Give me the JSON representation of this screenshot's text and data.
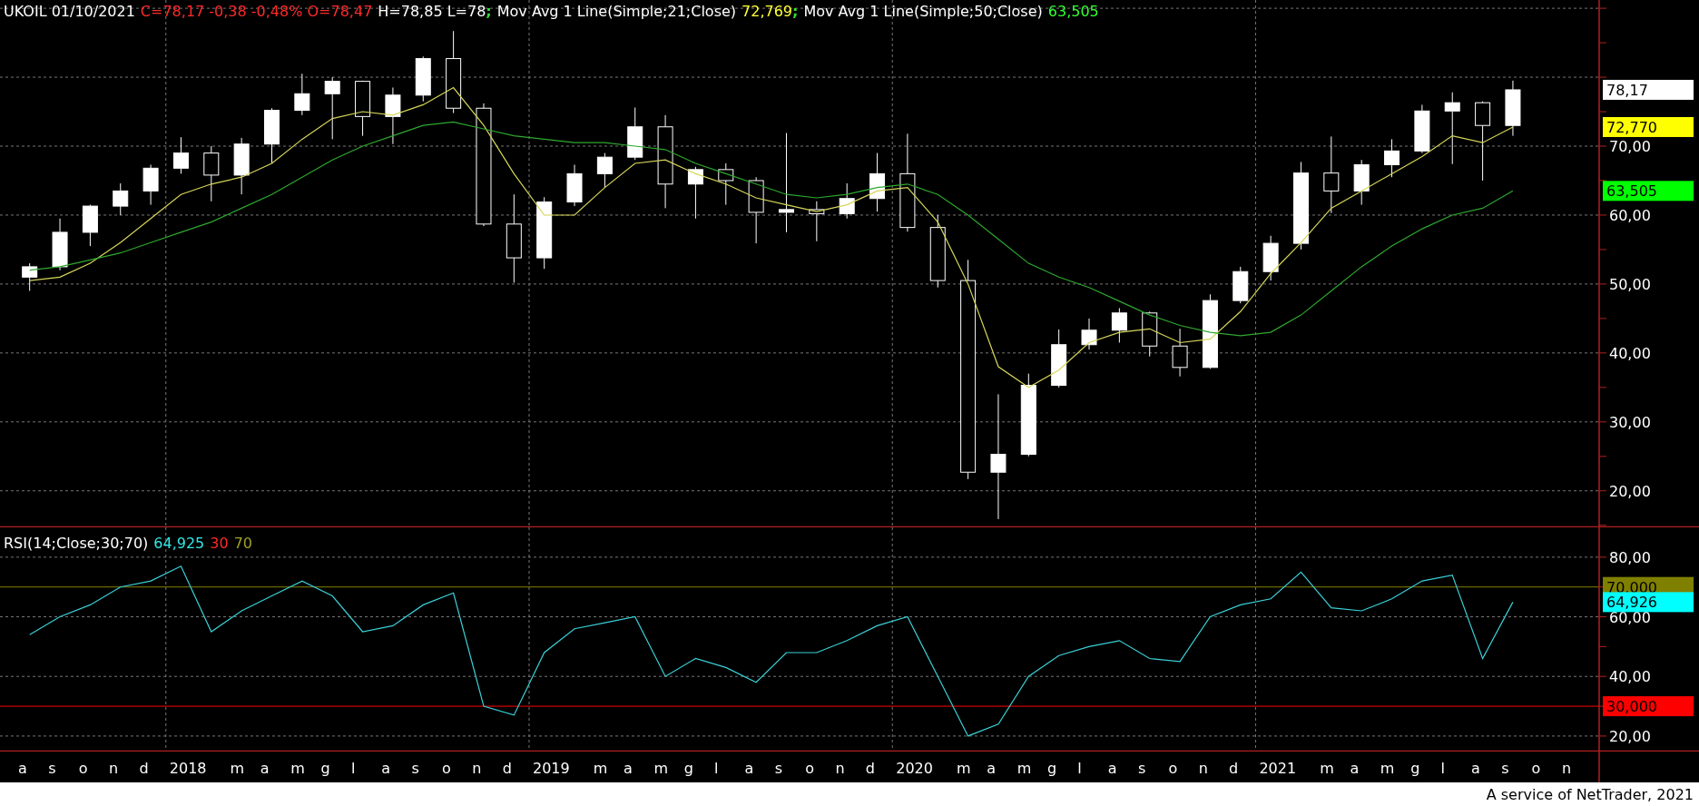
{
  "legend": [
    {
      "text": "UKOIL 01/10/2021",
      "color": "#ffffff",
      "joined": false
    },
    {
      "text": "C=78,17 -0,38 -0,48% O=78,47",
      "color": "#ff2a2a",
      "joined": false
    },
    {
      "text": "H=78,85 L=78",
      "color": "#ffffff",
      "joined": false
    },
    {
      "text": ";",
      "color": "#33dd33",
      "joined": true
    },
    {
      "text": "Mov Avg 1 Line(Simple;21;Close)",
      "color": "#ffffff",
      "joined": false
    },
    {
      "text": "72,769",
      "color": "#ffff33",
      "joined": false
    },
    {
      "text": ";",
      "color": "#33dd33",
      "joined": true
    },
    {
      "text": "Mov Avg 1 Line(Simple;50;Close)",
      "color": "#ffffff",
      "joined": false
    },
    {
      "text": "63,505",
      "color": "#33ff33",
      "joined": false
    }
  ],
  "price_chart": {
    "chart_data": {
      "type": "candlestick",
      "grid": true,
      "ylim": [
        14.7,
        91.2
      ],
      "categories": [
        null,
        null,
        null,
        null,
        null,
        null,
        null,
        null,
        null,
        null,
        null,
        null,
        null,
        null,
        null,
        null,
        null,
        null,
        null,
        null,
        null,
        null,
        null,
        null,
        null,
        null,
        null,
        null,
        null,
        null,
        null,
        null,
        null,
        null,
        null,
        null,
        null,
        null,
        null,
        null,
        null,
        null,
        null,
        null,
        null,
        null,
        null,
        null,
        null,
        null
      ],
      "yticks": [
        {
          "value": 20,
          "label": "20,00"
        },
        {
          "value": 30,
          "label": "30,00"
        },
        {
          "value": 40,
          "label": "40,00"
        },
        {
          "value": 50,
          "label": "50,00"
        },
        {
          "value": 60,
          "label": "60,00"
        },
        {
          "value": 70,
          "label": "70,00"
        }
      ],
      "ohlc": [
        [
          51,
          53,
          49,
          52.5
        ],
        [
          52.5,
          59.5,
          52,
          57.5
        ],
        [
          57.5,
          61.5,
          55.5,
          61.3
        ],
        [
          61.3,
          64.6,
          60,
          63.5
        ],
        [
          63.5,
          67.3,
          61.5,
          66.8
        ],
        [
          66.8,
          71.3,
          66,
          69
        ],
        [
          69,
          70,
          62,
          65.8
        ],
        [
          65.8,
          71.2,
          63,
          70.3
        ],
        [
          70.3,
          75.5,
          67.5,
          75.2
        ],
        [
          75.2,
          80.5,
          74.5,
          77.6
        ],
        [
          77.6,
          80,
          71,
          79.4
        ],
        [
          79.4,
          79.5,
          71.5,
          74.3
        ],
        [
          74.3,
          78.5,
          70.3,
          77.4
        ],
        [
          77.4,
          83,
          76.5,
          82.7
        ],
        [
          82.7,
          86.7,
          74.8,
          75.5
        ],
        [
          75.5,
          76.2,
          58.4,
          58.7
        ],
        [
          58.7,
          63,
          50.2,
          53.8
        ],
        [
          53.8,
          62.6,
          52.2,
          61.9
        ],
        [
          61.9,
          67.3,
          61.3,
          66
        ],
        [
          66,
          69,
          64,
          68.4
        ],
        [
          68.4,
          75.6,
          68,
          72.8
        ],
        [
          72.8,
          74.5,
          61,
          64.5
        ],
        [
          64.5,
          67,
          59.5,
          66.6
        ],
        [
          66.6,
          67.5,
          61.5,
          65
        ],
        [
          65,
          65.5,
          55.9,
          60.4
        ],
        [
          60.4,
          71.9,
          57.5,
          60.8
        ],
        [
          60.8,
          62,
          56.2,
          60.2
        ],
        [
          60.2,
          64.6,
          59.5,
          62.4
        ],
        [
          62.4,
          69,
          60.5,
          66
        ],
        [
          66,
          71.8,
          57.6,
          58.2
        ],
        [
          58.2,
          60,
          49.5,
          50.5
        ],
        [
          50.5,
          53.5,
          21.7,
          22.7
        ],
        [
          22.7,
          34,
          15.9,
          25.3
        ],
        [
          25.3,
          37,
          25,
          35.3
        ],
        [
          35.3,
          43.4,
          35,
          41.2
        ],
        [
          41.2,
          45,
          40.5,
          43.3
        ],
        [
          43.3,
          46.5,
          41.5,
          45.8
        ],
        [
          45.8,
          46,
          39.5,
          41
        ],
        [
          41,
          43.5,
          36.6,
          37.9
        ],
        [
          37.9,
          48.5,
          37.7,
          47.6
        ],
        [
          47.6,
          52.5,
          47.2,
          51.8
        ],
        [
          51.8,
          57,
          50.5,
          55.9
        ],
        [
          55.9,
          67.7,
          55,
          66.1
        ],
        [
          66.1,
          71.4,
          60.3,
          63.5
        ],
        [
          63.5,
          68,
          61.5,
          67.3
        ],
        [
          67.3,
          71,
          65.5,
          69.3
        ],
        [
          69.3,
          76,
          69,
          75.1
        ],
        [
          75.1,
          77.8,
          67.4,
          76.3
        ],
        [
          76.3,
          76.5,
          65,
          73
        ],
        [
          73,
          79.5,
          71.5,
          78.17
        ]
      ],
      "series": [
        {
          "type": "line",
          "color": "#d6d65a",
          "values": [
            50.5,
            51,
            53,
            56,
            59.5,
            63,
            64.5,
            65.5,
            67.5,
            71,
            74,
            75,
            74.5,
            76,
            78.5,
            73,
            66,
            60,
            60,
            64,
            67.5,
            68,
            66,
            64.5,
            62.5,
            61.5,
            60.5,
            61.5,
            63.5,
            64,
            59,
            50,
            38,
            35,
            37.5,
            41.5,
            43,
            43.5,
            41.5,
            42,
            46,
            51.5,
            56,
            61,
            63.5,
            66,
            68.5,
            71.5,
            70.5,
            72.77
          ]
        },
        {
          "type": "line",
          "color": "#2ea82e",
          "values": [
            52,
            52.5,
            53.5,
            54.5,
            56,
            57.5,
            59,
            61,
            63,
            65.5,
            68,
            70,
            71.5,
            73,
            73.5,
            72.5,
            71.5,
            71,
            70.5,
            70.5,
            70,
            69.5,
            67.5,
            66,
            64.5,
            63,
            62.5,
            63,
            64,
            64.5,
            63,
            60,
            56.5,
            53,
            51,
            49.5,
            47.5,
            45.5,
            44,
            43,
            42.5,
            43,
            45.5,
            49,
            52.5,
            55.5,
            58,
            60,
            61,
            63.505
          ]
        }
      ]
    }
  },
  "price_tags": [
    {
      "text": "78,17",
      "color": "#ffffff"
    },
    {
      "text": "72,770",
      "color": "#ffff00"
    },
    {
      "text": "63,505",
      "color": "#00ff00"
    }
  ],
  "rsi_legend": [
    {
      "text": "RSI(14;Close;30;70)",
      "color": "#ffffff"
    },
    {
      "text": "64,925",
      "color": "#33e6e6"
    },
    {
      "text": "30",
      "color": "#ff2a2a"
    },
    {
      "text": "70",
      "color": "#a0a028"
    }
  ],
  "rsi_chart": {
    "chart_data": {
      "type": "line",
      "grid": true,
      "ylim": [
        14.8,
        90
      ],
      "categories": [
        "a",
        "s",
        "o",
        "n",
        "d",
        "2018",
        null,
        "m",
        "a",
        "m",
        "g",
        "l",
        "a",
        "s",
        "o",
        "n",
        "d",
        "2019",
        null,
        "m",
        "a",
        "m",
        "g",
        "l",
        "a",
        "s",
        "o",
        "n",
        "d",
        "2020",
        null,
        "m",
        "a",
        "m",
        "g",
        "l",
        "a",
        "s",
        "o",
        "n",
        "d",
        "2021",
        null,
        "m",
        "a",
        "m",
        "g",
        "l",
        "a",
        "s"
      ],
      "yticks": [
        {
          "value": 20,
          "label": "20,00"
        },
        {
          "value": 40,
          "label": "40,00"
        },
        {
          "value": 60,
          "label": "60,00"
        },
        {
          "value": 80,
          "label": "80,00"
        }
      ],
      "ref_lines": [
        {
          "value": 70,
          "axis": "y",
          "color": "#808000",
          "label": "70,000"
        },
        {
          "value": 30,
          "axis": "y",
          "color": "#ff0000",
          "label": "30,000"
        }
      ],
      "series": [
        {
          "color": "#3ad0d8",
          "values": [
            54,
            60,
            64,
            70,
            72,
            77,
            55,
            62,
            67,
            72,
            67,
            55,
            57,
            64,
            68,
            30,
            27,
            48,
            56,
            58,
            60,
            40,
            46,
            43,
            38,
            48,
            48,
            52,
            57,
            60,
            40,
            20,
            24,
            40,
            47,
            50,
            52,
            46,
            45,
            60,
            64,
            66,
            75,
            63,
            62,
            66,
            72,
            74,
            46,
            64.925
          ]
        }
      ]
    }
  },
  "axis_tail": [
    "o",
    "n"
  ],
  "rsi_tags": [
    {
      "text": "64,926",
      "color": "#00ffff"
    }
  ],
  "footer": {
    "text": "A service of NetTrader, 2021"
  }
}
